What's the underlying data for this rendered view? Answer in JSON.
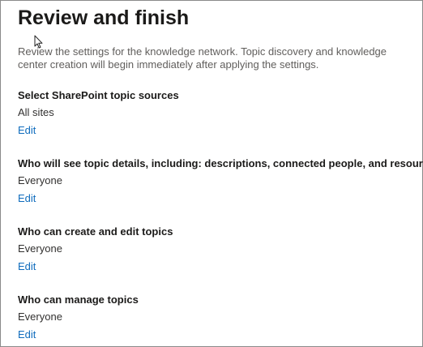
{
  "page": {
    "title": "Review and finish",
    "intro": "Review the settings for the knowledge network. Topic discovery and knowledge center creation will begin immediately after applying the settings."
  },
  "sections": [
    {
      "heading": "Select SharePoint topic sources",
      "value": "All sites",
      "edit_label": "Edit"
    },
    {
      "heading": "Who will see topic details, including: descriptions, connected people, and resources",
      "value": "Everyone",
      "edit_label": "Edit"
    },
    {
      "heading": "Who can create and edit topics",
      "value": "Everyone",
      "edit_label": "Edit"
    },
    {
      "heading": "Who can manage topics",
      "value": "Everyone",
      "edit_label": "Edit"
    }
  ],
  "icons": {
    "cursor": "mouse-pointer-icon"
  },
  "colors": {
    "link": "#0f6cbd",
    "heading": "#1b1a19",
    "body_text": "#323130",
    "intro_text": "#605e5c",
    "border": "#8a8a8a"
  }
}
